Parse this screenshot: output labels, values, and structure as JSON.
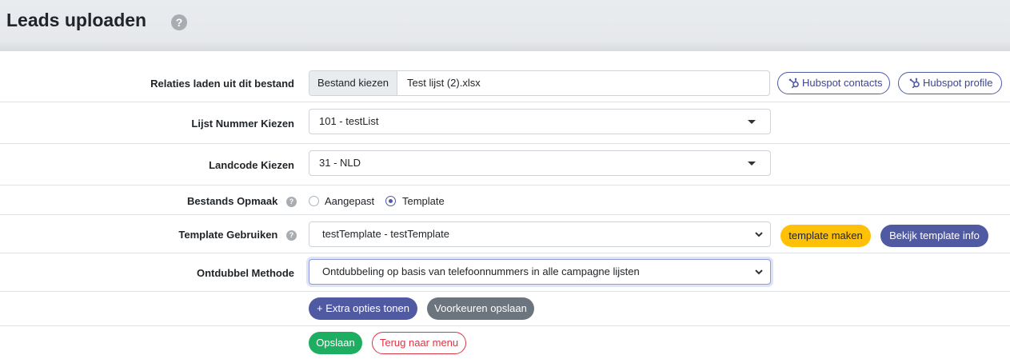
{
  "header": {
    "title": "Leads uploaden",
    "help_glyph": "?"
  },
  "file_row": {
    "label": "Relaties laden uit dit bestand",
    "choose_button": "Bestand kiezen",
    "file_name": "Test lijst (2).xlsx",
    "hubspot_contacts": "Hubspot contacts",
    "hubspot_profile": "Hubspot profile"
  },
  "list_row": {
    "label": "Lijst Nummer Kiezen",
    "value": "101 - testList"
  },
  "country_row": {
    "label": "Landcode Kiezen",
    "value": "31 - NLD"
  },
  "format_row": {
    "label": "Bestands Opmaak",
    "options": [
      {
        "label": "Aangepast",
        "checked": false
      },
      {
        "label": "Template",
        "checked": true
      }
    ]
  },
  "template_row": {
    "label": "Template Gebruiken",
    "value": "testTemplate - testTemplate",
    "make_button": "template maken",
    "info_button": "Bekijk template info"
  },
  "dedupe_row": {
    "label": "Ontdubbel Methode",
    "value": "Ontdubbeling op basis van telefoonnummers in alle campagne lijsten"
  },
  "extras_row": {
    "extra_options_button": "+ Extra opties tonen",
    "save_preferences_button": "Voorkeuren opslaan"
  },
  "actions_row": {
    "save_button": "Opslaan",
    "back_button": "Terug naar menu"
  },
  "colors": {
    "primary": "#4f5aa3",
    "warning": "#ffc107",
    "secondary": "#6c757d",
    "success": "#1eae62",
    "danger": "#dc3545"
  },
  "icons": {
    "help": "question-circle-icon",
    "hubspot": "hubspot-icon",
    "caret": "caret-down-icon",
    "chevron": "chevron-down-icon"
  }
}
